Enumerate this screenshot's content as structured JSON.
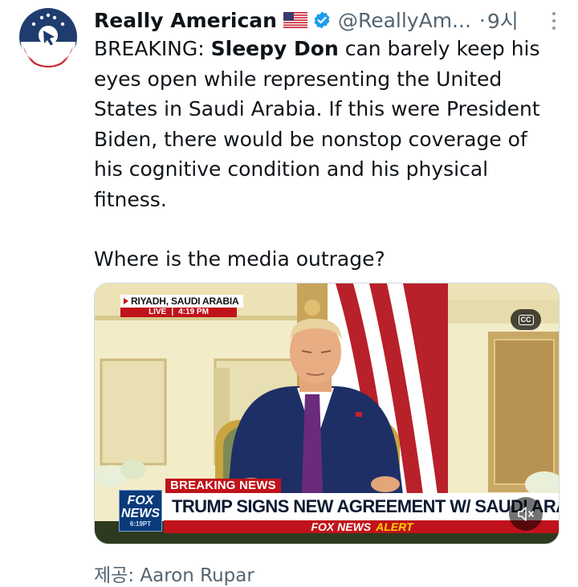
{
  "author": {
    "display_name": "Really American",
    "handle": "@ReallyAm...",
    "separator": "·",
    "time": "9시",
    "verified": true,
    "flag": "us-flag-emoji"
  },
  "tweet": {
    "prefix": "BREAKING: ",
    "bold_name": "Sleepy Don",
    "body": " can barely keep his eyes open while representing the United States in Saudi Arabia. If this were President Biden, there would be nonstop coverage of his cognitive condition and his physical fitness.",
    "second_paragraph": "Where is the media outrage?"
  },
  "video": {
    "location": "RIYADH, SAUDI ARABIA",
    "live_label": "LIVE",
    "live_separator": "|",
    "live_time": "4:19 PM",
    "cc_label": "CC",
    "breaking_label": "BREAKING NEWS",
    "channel_top": "FOX",
    "channel_bottom": "NEWS",
    "channel_time": "6:19PT",
    "headline": "TRUMP SIGNS NEW AGREEMENT W/ SAUDI ARABIA",
    "alert_brand": "FOX NEWS",
    "alert_word": "ALERT"
  },
  "footer": {
    "provided_by": "제공: Aaron Rupar"
  },
  "colors": {
    "brand_red": "#c0121a",
    "fox_navy": "#0a3a7a",
    "verified_blue": "#1d9bf0",
    "muted_text": "#536471"
  }
}
